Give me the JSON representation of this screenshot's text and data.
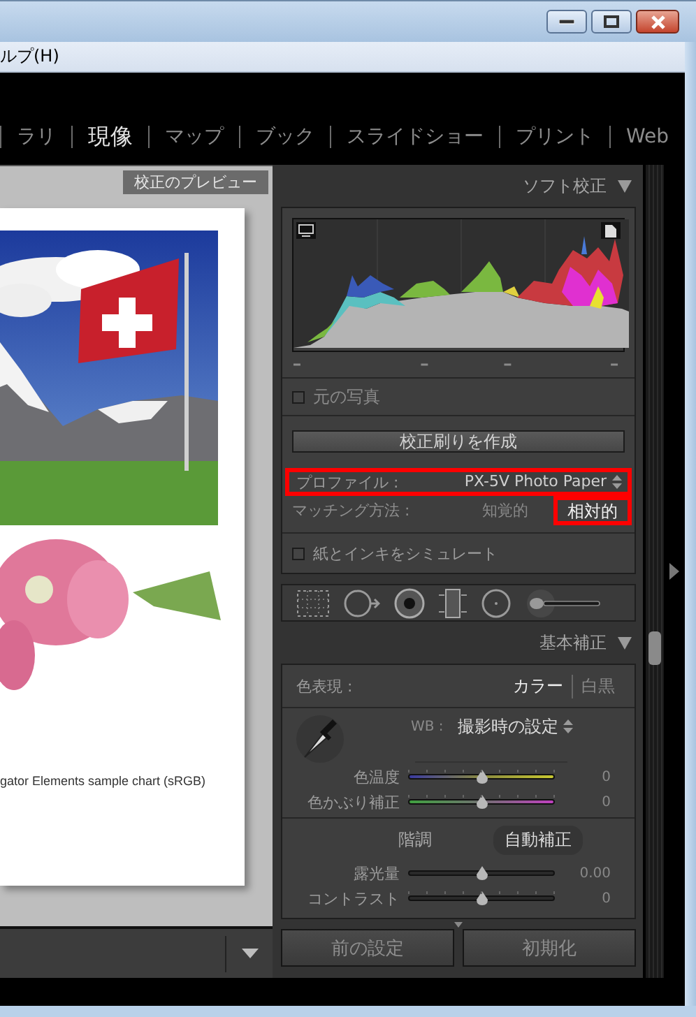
{
  "menu": {
    "items": [
      "ルプ(H)"
    ]
  },
  "modules": [
    {
      "label": "ラリ",
      "selected": false
    },
    {
      "label": "現像",
      "selected": true
    },
    {
      "label": "マップ",
      "selected": false
    },
    {
      "label": "ブック",
      "selected": false
    },
    {
      "label": "スライドショー",
      "selected": false
    },
    {
      "label": "プリント",
      "selected": false
    },
    {
      "label": "Web",
      "selected": false
    }
  ],
  "preview": {
    "badge": "校正のプレビュー",
    "caption": "gator Elements sample chart (sRGB)"
  },
  "soft_proofing": {
    "title": "ソフト校正",
    "expanded": true,
    "show_original": {
      "label": "元の写真",
      "checked": false
    },
    "create_proof": "校正刷りを作成",
    "profile": {
      "label": "プロファイル :",
      "value": "PX-5V Photo Paper",
      "highlighted": true
    },
    "intent": {
      "label": "マッチング方法 :",
      "options": [
        {
          "label": "知覚的",
          "selected": false,
          "highlighted": false
        },
        {
          "label": "相対的",
          "selected": true,
          "highlighted": true
        }
      ]
    },
    "simulate": {
      "label": "紙とインキをシミュレート",
      "checked": false
    }
  },
  "basic": {
    "title": "基本補正",
    "expanded": true,
    "treatment": {
      "label": "色表現 :",
      "options": [
        {
          "label": "カラー",
          "selected": true
        },
        {
          "label": "白黒",
          "selected": false
        }
      ]
    },
    "wb": {
      "label": "WB :",
      "value": "撮影時の設定"
    },
    "wb_sliders": [
      {
        "label": "色温度",
        "kind": "temp",
        "level": 0.5,
        "reading": "0"
      },
      {
        "label": "色かぶり補正",
        "kind": "tint",
        "level": 0.5,
        "reading": "0"
      }
    ],
    "tone": {
      "label": "階調",
      "auto": "自動補正"
    },
    "tone_sliders": [
      {
        "label": "露光量",
        "kind": "plain",
        "level": 0.5,
        "reading": "0.00"
      },
      {
        "label": "コントラスト",
        "kind": "ticked",
        "level": 0.5,
        "reading": "0"
      }
    ]
  },
  "buttons": [
    "前の設定",
    "初期化"
  ]
}
